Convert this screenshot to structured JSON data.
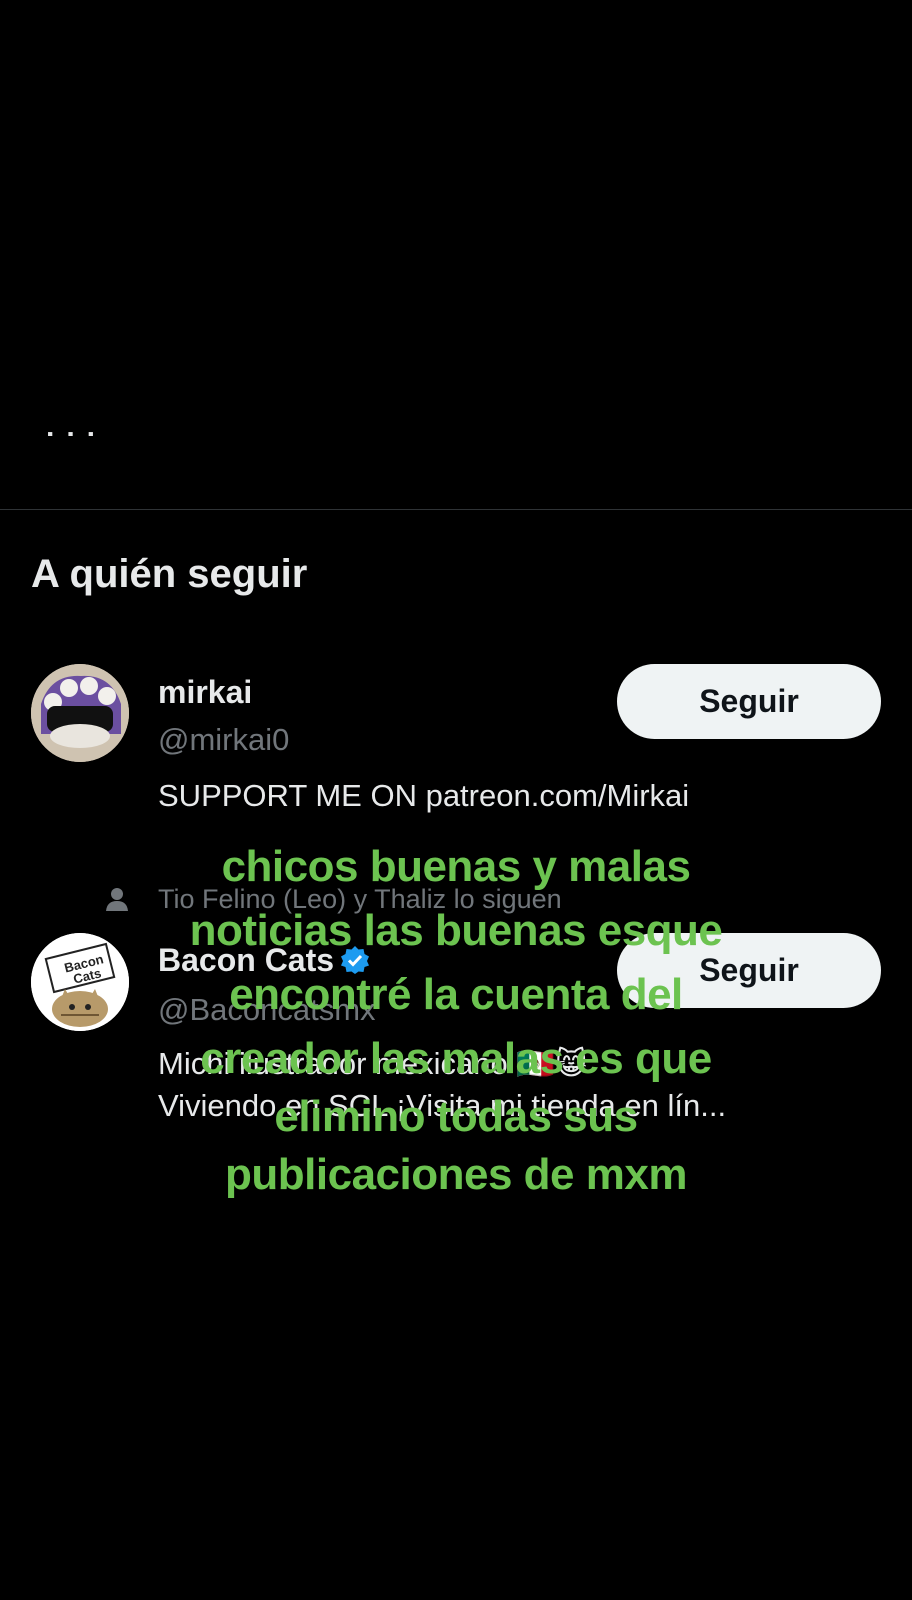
{
  "prev_tweet": {
    "cut_text": "· · ·"
  },
  "section": {
    "title": "A quién seguir"
  },
  "suggestions": [
    {
      "name": "mirkai",
      "handle": "@mirkai0",
      "bio_line1": "SUPPORT ME ON patreon.com/Mirkai",
      "bio_line2": "",
      "follow_label": "Seguir"
    },
    {
      "social_context": "Tio Felino (Leo) y Thaliz lo siguen",
      "name": "Bacon Cats",
      "handle": "@Baconcatsmx",
      "bio_line1": "Michi ilustrador mexicano 🇲🇽😸",
      "bio_line2": "Viviendo en SCL ¡Visita mi tienda en lín...",
      "follow_label": "Seguir",
      "avatar_text_1": "Bacon",
      "avatar_text_2": "Cats"
    }
  ],
  "overlay_caption": {
    "lines": [
      "chicos buenas y malas",
      "noticias las buenas esque",
      "encontré la cuenta del",
      "creador las malas es que",
      "elimino  todas sus",
      "publicaciones de mxm"
    ]
  },
  "colors": {
    "background": "#000000",
    "caption": "#6cc350",
    "button_bg": "#eff3f4",
    "secondary_text": "#71767b",
    "verified": "#1d9bf0"
  }
}
